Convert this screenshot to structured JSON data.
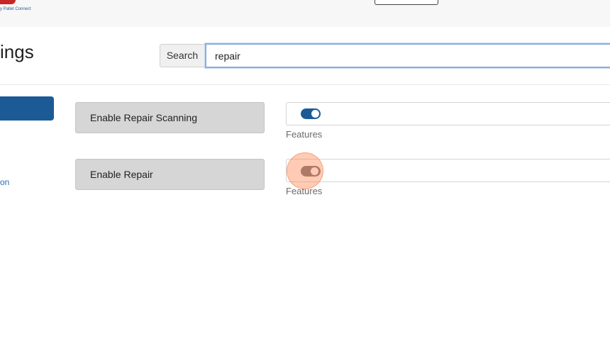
{
  "header": {
    "brand_text": "y Pallet Connect"
  },
  "page": {
    "title": "ings"
  },
  "search": {
    "label": "Search",
    "value": "repair"
  },
  "sidebar": {
    "partial_link": "on"
  },
  "settings": [
    {
      "label": "Enable Repair Scanning",
      "enabled": true,
      "category": "Features"
    },
    {
      "label": "Enable Repair",
      "enabled": false,
      "category": "Features"
    }
  ],
  "colors": {
    "accent": "#1c5a96",
    "toggle_off": "#6c6c74",
    "label_bg": "#d6d6d6",
    "click_highlight": "#ff8c5a"
  }
}
